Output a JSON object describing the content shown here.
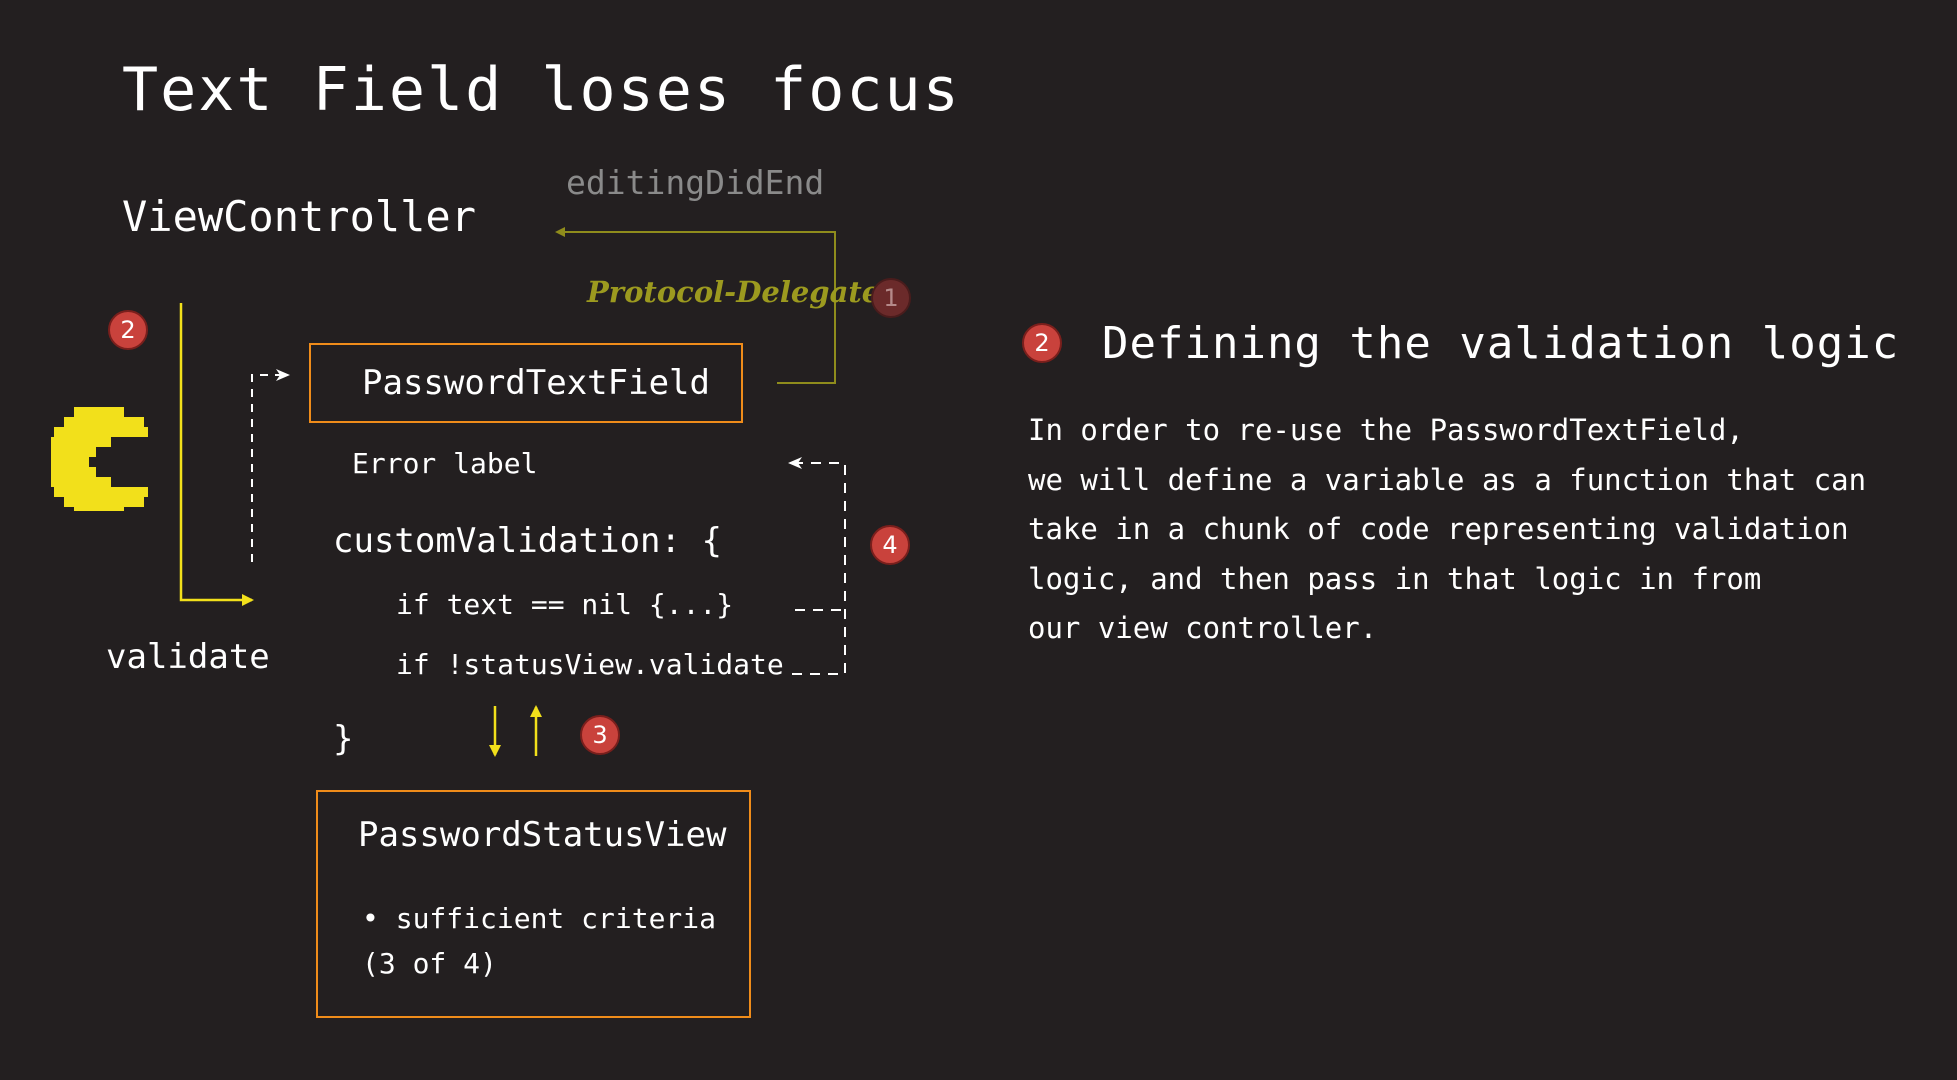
{
  "title": "Text Field loses focus",
  "diagram": {
    "view_controller": "ViewController",
    "event_label": "editingDidEnd",
    "protocol_label": "Protocol-Delegate",
    "validate_label": "validate",
    "password_text_field": "PasswordTextField",
    "error_label": "Error label",
    "custom_validation": "customValidation: {",
    "code_line_1": "if text == nil {...}",
    "code_line_2": "if !statusView.validate",
    "closing_brace": "}",
    "password_status_view": "PasswordStatusView",
    "criteria_line_1": "• sufficient criteria",
    "criteria_line_2": "(3 of 4)",
    "steps": {
      "step_1": "1",
      "step_2": "2",
      "step_3": "3",
      "step_4": "4"
    },
    "icon": "pacman-icon"
  },
  "explanation": {
    "step": "2",
    "heading": "Defining the validation logic",
    "lines": [
      "In order to re-use the PasswordTextField,",
      "we will define a variable as a function that can",
      "take in a chunk of code representing validation",
      "logic, and then pass in that logic in from",
      "our view controller."
    ]
  },
  "colors": {
    "background": "#231f20",
    "box_border": "#f08c1a",
    "arrow_yellow": "#f2e01b",
    "arrow_olive": "#8f8c1c",
    "badge_red": "#c9423c",
    "badge_dark": "#6b2a2a"
  }
}
